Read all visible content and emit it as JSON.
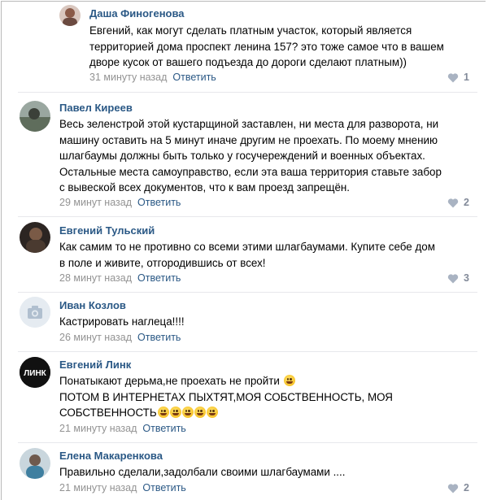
{
  "comments": [
    {
      "author": "Даша Финогенова",
      "lines": "Евгений, как могут сделать платным участок, который является\nтерриторией дома проспект ленина 157? это тоже самое что в вашем\nдворе кусок от вашего подъезда до дороги сделают платным))",
      "time": "31 минуту назад",
      "reply": "Ответить",
      "likes": "1"
    },
    {
      "author": "Павел Киреев",
      "lines": "Весь зеленстрой этой кустарщиной заставлен, ни места для разворота, ни\nмашину оставить на 5 минут иначе другим не проехать. По моему мнению\nшлагбаумы должны быть только у госучереждений и военных объектах.\nОстальные места самоуправство, если эта ваша территория ставьте забор\nс вывеской всех документов, что к вам проезд запрещён.",
      "time": "29 минут назад",
      "reply": "Ответить",
      "likes": "2"
    },
    {
      "author": "Евгений Тульский",
      "lines": "Как самим то не противно со всеми этими шлагбаумами. Купите себе дом\nв поле и живите, отгородившись от всех!",
      "time": "28 минут назад",
      "reply": "Ответить",
      "likes": "3"
    },
    {
      "author": "Иван Козлов",
      "lines": "Кастрировать наглеца!!!!",
      "time": "26 минут назад",
      "reply": "Ответить",
      "likes": ""
    },
    {
      "author": "Евгений Линк",
      "line1": "Понатыкают дерьма,не проехать не пройти",
      "line2": "ПОТОМ В ИНТЕРНЕТАХ ПЫХТЯТ,МОЯ СОБСТВЕННОСТЬ, МОЯ",
      "line3": "СОБСТВЕННОСТЬ",
      "avatar_text": "ЛИНК",
      "time": "21 минуту назад",
      "reply": "Ответить",
      "likes": ""
    },
    {
      "author": "Елена Макаренкова",
      "lines": "Правильно сделали,задолбали своими шлагбаумами ....",
      "time": "21 минуту назад",
      "reply": "Ответить",
      "likes": "2"
    }
  ],
  "colors": {
    "link": "#2a5885",
    "meta": "#939393",
    "divider": "#e7e8ec"
  }
}
